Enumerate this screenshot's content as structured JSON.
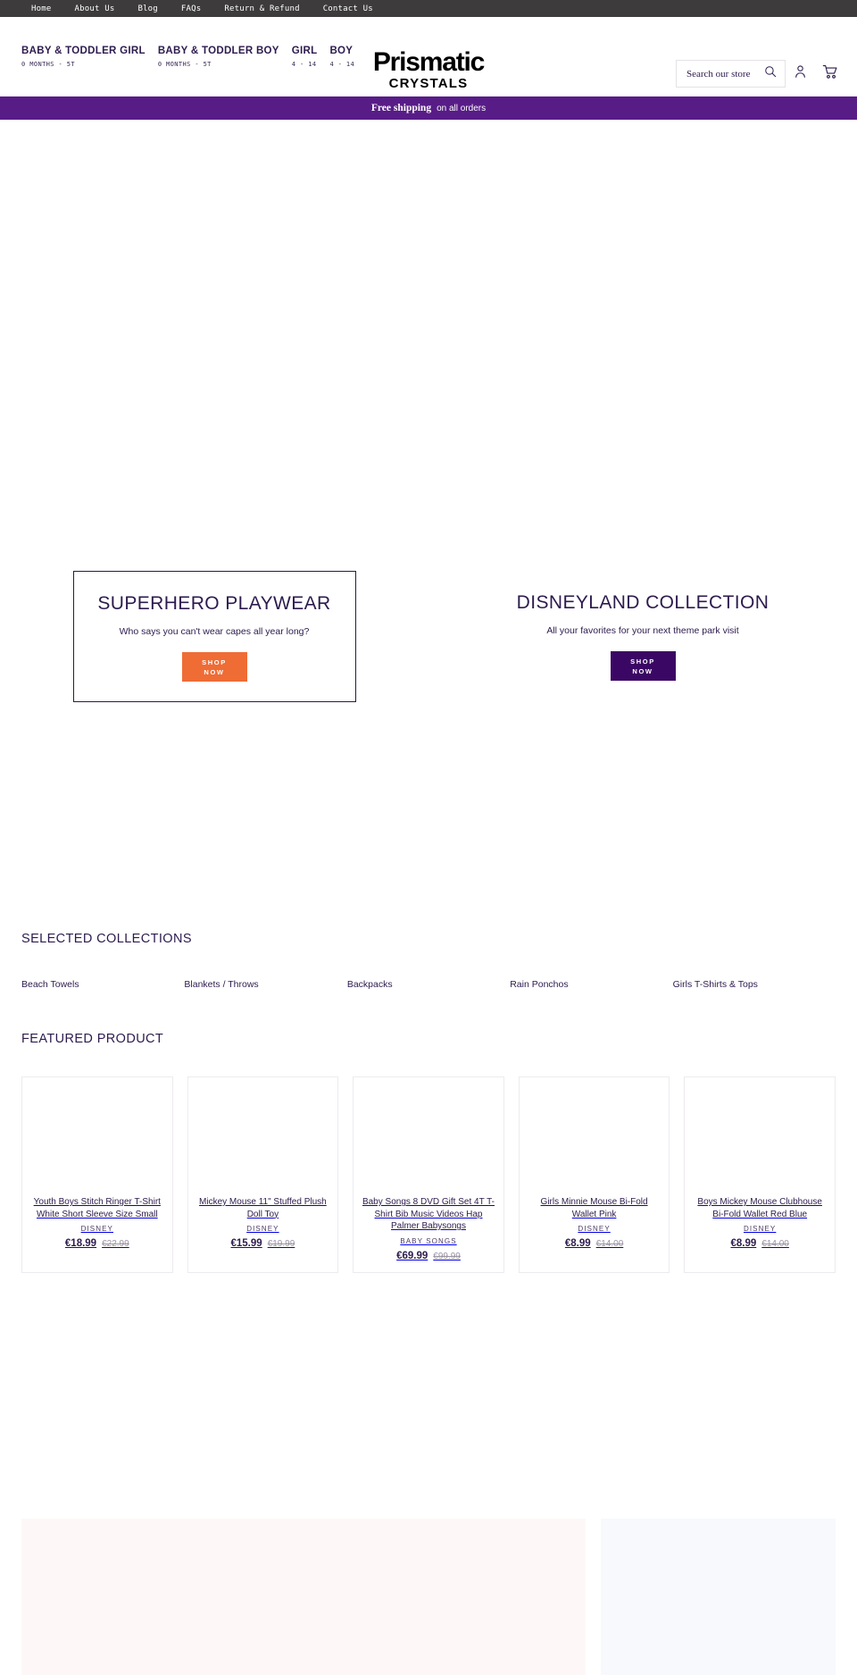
{
  "utility_nav": {
    "links": [
      {
        "label": "Home"
      },
      {
        "label": "About Us"
      },
      {
        "label": "Blog"
      },
      {
        "label": "FAQs"
      },
      {
        "label": "Return & Refund"
      },
      {
        "label": "Contact Us"
      }
    ]
  },
  "header": {
    "categories": [
      {
        "title": "BABY & TODDLER GIRL",
        "sub": "0 MONTHS - 5T"
      },
      {
        "title": "BABY & TODDLER BOY",
        "sub": "0 MONTHS - 5T"
      },
      {
        "title": "GIRL",
        "sub": "4 - 14"
      },
      {
        "title": "BOY",
        "sub": "4 - 14"
      }
    ],
    "logo": {
      "main": "Prismatic",
      "sub": "CRYSTALS"
    },
    "search": {
      "placeholder": "Search our store",
      "icon": "search-icon"
    },
    "account_icon": "user-icon",
    "cart_icon": "cart-icon"
  },
  "announcement": {
    "strong": "Free shipping",
    "text": "on all orders",
    "background": "#581c87"
  },
  "promos": [
    {
      "title": "SUPERHERO PLAYWEAR",
      "subtitle": "Who says you can't wear capes all year long?",
      "button_line1": "SHOP",
      "button_line2": "NOW",
      "button_color": "#ef6c35",
      "boxed": true
    },
    {
      "title": "DISNEYLAND COLLECTION",
      "subtitle": "All your favorites for your next theme park visit",
      "button_line1": "SHOP",
      "button_line2": "NOW",
      "button_color": "#3b0764",
      "boxed": false
    }
  ],
  "collections": {
    "heading": "SELECTED COLLECTIONS",
    "items": [
      {
        "label": "Beach Towels"
      },
      {
        "label": "Blankets / Throws"
      },
      {
        "label": "Backpacks"
      },
      {
        "label": "Rain Ponchos"
      },
      {
        "label": "Girls T-Shirts & Tops"
      }
    ]
  },
  "featured": {
    "heading": "FEATURED PRODUCT",
    "products": [
      {
        "title": "Youth Boys Stitch Ringer T-Shirt White Short Sleeve Size Small",
        "vendor": "DISNEY",
        "price": "€18.99",
        "compare_at": "€22.99"
      },
      {
        "title": "Mickey Mouse 11\" Stuffed Plush Doll Toy",
        "vendor": "DISNEY",
        "price": "€15.99",
        "compare_at": "€19.99"
      },
      {
        "title": "Baby Songs 8 DVD Gift Set 4T T-Shirt Bib Music Videos Hap Palmer Babysongs",
        "vendor": "BABY SONGS",
        "price": "€69.99",
        "compare_at": "€99.99"
      },
      {
        "title": "Girls Minnie Mouse Bi-Fold Wallet Pink",
        "vendor": "DISNEY",
        "price": "€8.99",
        "compare_at": "€14.00"
      },
      {
        "title": "Boys Mickey Mouse Clubhouse Bi-Fold Wallet Red Blue",
        "vendor": "DISNEY",
        "price": "€8.99",
        "compare_at": "€14.00"
      }
    ]
  },
  "bottom_panels": {
    "wide_color": "#fdf8f7",
    "narrow_color": "#f7f9fd"
  }
}
